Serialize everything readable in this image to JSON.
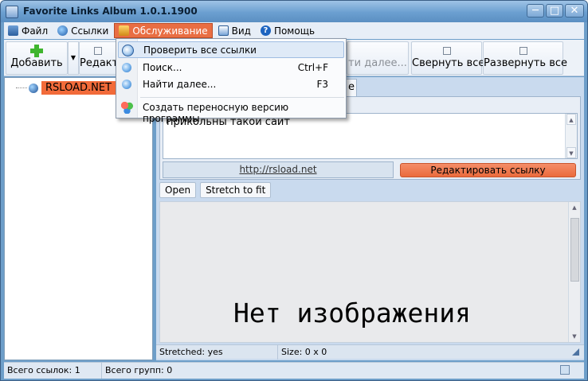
{
  "window": {
    "title": "Favorite Links Album 1.0.1.1900",
    "min": "─",
    "max": "□",
    "close": "✕"
  },
  "menu": {
    "file": "Файл",
    "links": "Ссылки",
    "service": "Обслуживание",
    "view": "Вид",
    "help": "Помощь",
    "help_glyph": "?"
  },
  "toolbar": {
    "add": "Добавить",
    "edit": "Редакти",
    "find_next_partial": "ти далее...",
    "collapse_all": "Свернуть все",
    "expand_all": "Развернуть все",
    "dropdown_arrow": "▼"
  },
  "dropdown": {
    "items": [
      {
        "label": "Проверить все ссылки",
        "shortcut": "",
        "icon": "check-links-icon"
      },
      {
        "label": "Поиск...",
        "shortcut": "Ctrl+F",
        "icon": "search-icon"
      },
      {
        "label": "Найти далее...",
        "shortcut": "F3",
        "icon": "find-next-icon"
      },
      {
        "label": "Создать переносную версию программы",
        "shortcut": "",
        "icon": "portable-version-icon"
      }
    ]
  },
  "tree": {
    "root_label": "RSLOAD.NET"
  },
  "detail": {
    "tab_fragment": "е",
    "description": "прикольны такой сайт",
    "url": "http://rsload.net",
    "edit_link": "Редактировать ссылку",
    "open": "Open",
    "stretch": "Stretch to fit",
    "no_image": "Нет изображения",
    "stretched": "Stretched: yes",
    "size": "Size: 0 x 0",
    "scroll_up": "▲",
    "scroll_down": "▼"
  },
  "status": {
    "total_links": "Всего ссылок: 1",
    "total_groups": "Всего групп: 0"
  },
  "colors": {
    "accent": "#e96e43",
    "title_bar": "#6b9fd0",
    "selection": "#f26b3a"
  }
}
